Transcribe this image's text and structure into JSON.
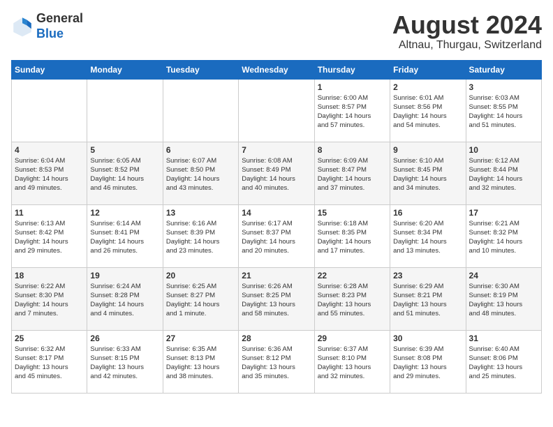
{
  "header": {
    "logo_line1": "General",
    "logo_line2": "Blue",
    "month_title": "August 2024",
    "location": "Altnau, Thurgau, Switzerland"
  },
  "days_of_week": [
    "Sunday",
    "Monday",
    "Tuesday",
    "Wednesday",
    "Thursday",
    "Friday",
    "Saturday"
  ],
  "weeks": [
    [
      {
        "day": "",
        "info": ""
      },
      {
        "day": "",
        "info": ""
      },
      {
        "day": "",
        "info": ""
      },
      {
        "day": "",
        "info": ""
      },
      {
        "day": "1",
        "info": "Sunrise: 6:00 AM\nSunset: 8:57 PM\nDaylight: 14 hours\nand 57 minutes."
      },
      {
        "day": "2",
        "info": "Sunrise: 6:01 AM\nSunset: 8:56 PM\nDaylight: 14 hours\nand 54 minutes."
      },
      {
        "day": "3",
        "info": "Sunrise: 6:03 AM\nSunset: 8:55 PM\nDaylight: 14 hours\nand 51 minutes."
      }
    ],
    [
      {
        "day": "4",
        "info": "Sunrise: 6:04 AM\nSunset: 8:53 PM\nDaylight: 14 hours\nand 49 minutes."
      },
      {
        "day": "5",
        "info": "Sunrise: 6:05 AM\nSunset: 8:52 PM\nDaylight: 14 hours\nand 46 minutes."
      },
      {
        "day": "6",
        "info": "Sunrise: 6:07 AM\nSunset: 8:50 PM\nDaylight: 14 hours\nand 43 minutes."
      },
      {
        "day": "7",
        "info": "Sunrise: 6:08 AM\nSunset: 8:49 PM\nDaylight: 14 hours\nand 40 minutes."
      },
      {
        "day": "8",
        "info": "Sunrise: 6:09 AM\nSunset: 8:47 PM\nDaylight: 14 hours\nand 37 minutes."
      },
      {
        "day": "9",
        "info": "Sunrise: 6:10 AM\nSunset: 8:45 PM\nDaylight: 14 hours\nand 34 minutes."
      },
      {
        "day": "10",
        "info": "Sunrise: 6:12 AM\nSunset: 8:44 PM\nDaylight: 14 hours\nand 32 minutes."
      }
    ],
    [
      {
        "day": "11",
        "info": "Sunrise: 6:13 AM\nSunset: 8:42 PM\nDaylight: 14 hours\nand 29 minutes."
      },
      {
        "day": "12",
        "info": "Sunrise: 6:14 AM\nSunset: 8:41 PM\nDaylight: 14 hours\nand 26 minutes."
      },
      {
        "day": "13",
        "info": "Sunrise: 6:16 AM\nSunset: 8:39 PM\nDaylight: 14 hours\nand 23 minutes."
      },
      {
        "day": "14",
        "info": "Sunrise: 6:17 AM\nSunset: 8:37 PM\nDaylight: 14 hours\nand 20 minutes."
      },
      {
        "day": "15",
        "info": "Sunrise: 6:18 AM\nSunset: 8:35 PM\nDaylight: 14 hours\nand 17 minutes."
      },
      {
        "day": "16",
        "info": "Sunrise: 6:20 AM\nSunset: 8:34 PM\nDaylight: 14 hours\nand 13 minutes."
      },
      {
        "day": "17",
        "info": "Sunrise: 6:21 AM\nSunset: 8:32 PM\nDaylight: 14 hours\nand 10 minutes."
      }
    ],
    [
      {
        "day": "18",
        "info": "Sunrise: 6:22 AM\nSunset: 8:30 PM\nDaylight: 14 hours\nand 7 minutes."
      },
      {
        "day": "19",
        "info": "Sunrise: 6:24 AM\nSunset: 8:28 PM\nDaylight: 14 hours\nand 4 minutes."
      },
      {
        "day": "20",
        "info": "Sunrise: 6:25 AM\nSunset: 8:27 PM\nDaylight: 14 hours\nand 1 minute."
      },
      {
        "day": "21",
        "info": "Sunrise: 6:26 AM\nSunset: 8:25 PM\nDaylight: 13 hours\nand 58 minutes."
      },
      {
        "day": "22",
        "info": "Sunrise: 6:28 AM\nSunset: 8:23 PM\nDaylight: 13 hours\nand 55 minutes."
      },
      {
        "day": "23",
        "info": "Sunrise: 6:29 AM\nSunset: 8:21 PM\nDaylight: 13 hours\nand 51 minutes."
      },
      {
        "day": "24",
        "info": "Sunrise: 6:30 AM\nSunset: 8:19 PM\nDaylight: 13 hours\nand 48 minutes."
      }
    ],
    [
      {
        "day": "25",
        "info": "Sunrise: 6:32 AM\nSunset: 8:17 PM\nDaylight: 13 hours\nand 45 minutes."
      },
      {
        "day": "26",
        "info": "Sunrise: 6:33 AM\nSunset: 8:15 PM\nDaylight: 13 hours\nand 42 minutes."
      },
      {
        "day": "27",
        "info": "Sunrise: 6:35 AM\nSunset: 8:13 PM\nDaylight: 13 hours\nand 38 minutes."
      },
      {
        "day": "28",
        "info": "Sunrise: 6:36 AM\nSunset: 8:12 PM\nDaylight: 13 hours\nand 35 minutes."
      },
      {
        "day": "29",
        "info": "Sunrise: 6:37 AM\nSunset: 8:10 PM\nDaylight: 13 hours\nand 32 minutes."
      },
      {
        "day": "30",
        "info": "Sunrise: 6:39 AM\nSunset: 8:08 PM\nDaylight: 13 hours\nand 29 minutes."
      },
      {
        "day": "31",
        "info": "Sunrise: 6:40 AM\nSunset: 8:06 PM\nDaylight: 13 hours\nand 25 minutes."
      }
    ]
  ]
}
